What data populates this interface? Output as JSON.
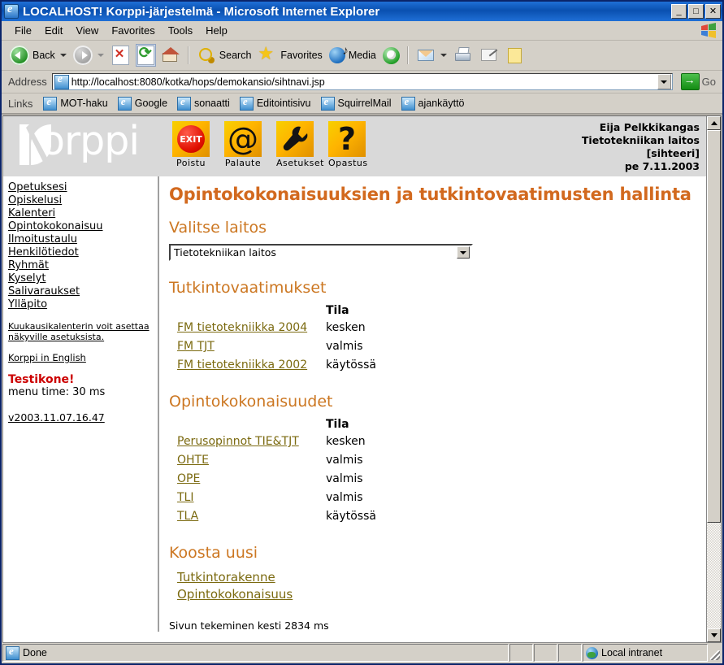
{
  "window": {
    "title": "LOCALHOST! Korppi-järjestelmä - Microsoft Internet Explorer",
    "minimize_label": "_",
    "maximize_label": "□",
    "close_label": "✕"
  },
  "menu": {
    "items": [
      "File",
      "Edit",
      "View",
      "Favorites",
      "Tools",
      "Help"
    ]
  },
  "toolbar": {
    "back_label": "Back",
    "search_label": "Search",
    "favorites_label": "Favorites",
    "media_label": "Media"
  },
  "address": {
    "label": "Address",
    "url": "http://localhost:8080/kotka/hops/demokansio/sihtnavi.jsp",
    "go_label": "Go"
  },
  "links": {
    "label": "Links",
    "items": [
      "MOT-haku",
      "Google",
      "sonaatti",
      "Editointisivu",
      "SquirrelMail",
      "ajankäyttö"
    ]
  },
  "korppi_header": {
    "logo_text": "orppi",
    "icons": [
      {
        "label": "Poistu",
        "glyph": "EXIT"
      },
      {
        "label": "Palaute",
        "glyph": "@"
      },
      {
        "label": "Asetukset",
        "glyph": "wrench"
      },
      {
        "label": "Opastus",
        "glyph": "?"
      }
    ],
    "user_lines": [
      "Eija Pelkkikangas",
      "Tietotekniikan laitos",
      "[sihteeri]",
      "pe 7.11.2003"
    ]
  },
  "sidebar": {
    "nav_items": [
      "Opetuksesi",
      "Opiskelusi",
      "Kalenteri",
      "Opintokokonaisuu",
      "Ilmoitustaulu",
      "Henkilötiedot",
      "Ryhmät",
      "Kyselyt",
      "Salivaraukset",
      "Ylläpito"
    ],
    "note": "Kuukausikalenterin voit asettaa näkyville asetuksista.",
    "english_link": "Korppi in English",
    "testikone": "Testikone!",
    "menu_time": "menu time: 30 ms",
    "version": "v2003.11.07.16.47"
  },
  "main": {
    "page_title": "Opintokokonaisuuksien ja tutkintovaatimusten hallinta",
    "select_dept_heading": "Valitse laitos",
    "select_dept_value": "Tietotekniikan laitos",
    "degree_heading": "Tutkintovaatimukset",
    "degree_status_header": "Tila",
    "degree_rows": [
      {
        "name": "FM tietotekniikka 2004",
        "status": "kesken"
      },
      {
        "name": "FM TJT",
        "status": "valmis"
      },
      {
        "name": "FM tietotekniikka 2002",
        "status": "käytössä"
      }
    ],
    "modules_heading": "Opintokokonaisuudet",
    "modules_status_header": "Tila",
    "modules_rows": [
      {
        "name": "Perusopinnot TIE&TJT",
        "status": "kesken"
      },
      {
        "name": "OHTE",
        "status": "valmis"
      },
      {
        "name": "OPE",
        "status": "valmis"
      },
      {
        "name": "TLI",
        "status": "valmis"
      },
      {
        "name": "TLA",
        "status": "käytössä"
      }
    ],
    "compose_heading": "Koosta uusi",
    "compose_links": [
      "Tutkintorakenne",
      "Opintokokonaisuus"
    ],
    "footnote": "Sivun tekeminen kesti 2834 ms"
  },
  "statusbar": {
    "status": "Done",
    "zone": "Local intranet"
  },
  "colors": {
    "titlebar_blue": "#0a50b0",
    "chrome_gray": "#d4d0c8",
    "heading_orange": "#cc7722",
    "title_orange": "#d2691e",
    "link_olive": "#7b6a10",
    "alert_red": "#cc0000",
    "korppi_band": "#d9d9d9",
    "icon_yellow": "#ffb400"
  }
}
